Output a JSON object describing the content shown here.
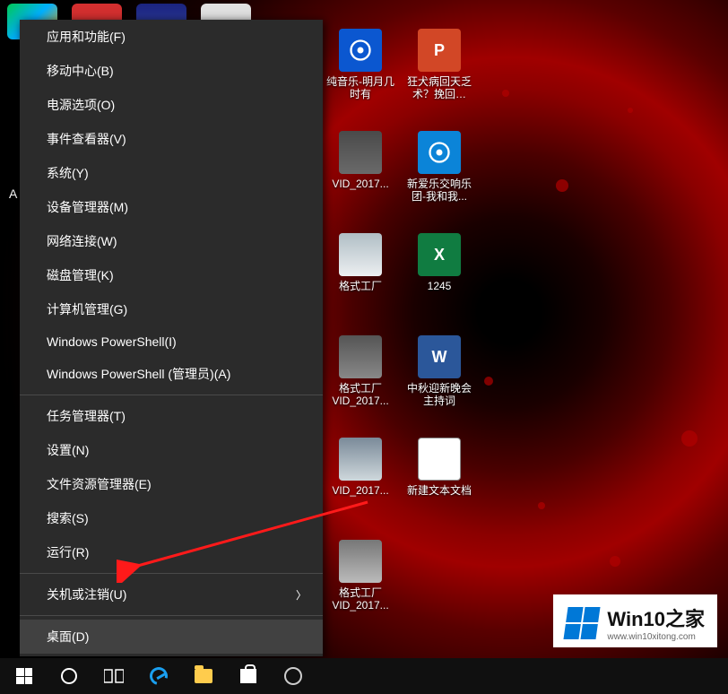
{
  "menu": {
    "section1": [
      "应用和功能(F)",
      "移动中心(B)",
      "电源选项(O)",
      "事件查看器(V)",
      "系统(Y)",
      "设备管理器(M)",
      "网络连接(W)",
      "磁盘管理(K)",
      "计算机管理(G)",
      "Windows PowerShell(I)",
      "Windows PowerShell (管理员)(A)"
    ],
    "section2": [
      "任务管理器(T)",
      "设置(N)",
      "文件资源管理器(E)",
      "搜索(S)",
      "运行(R)"
    ],
    "section3_sub": "关机或注销(U)",
    "section4": "桌面(D)"
  },
  "desktop": {
    "col1": [
      {
        "label": "纯音乐-明月几时有"
      },
      {
        "label": "VID_2017..."
      },
      {
        "label": "格式工厂"
      },
      {
        "label": "格式工厂\nVID_2017..."
      },
      {
        "label": "VID_2017..."
      },
      {
        "label": "格式工厂\nVID_2017..."
      }
    ],
    "col2": [
      {
        "label": "狂犬病回天乏术？挽回…"
      },
      {
        "label": "新爱乐交响乐团-我和我..."
      },
      {
        "label": "1245"
      },
      {
        "label": "中秋迎新晚会主持词"
      },
      {
        "label": "新建文本文档"
      }
    ]
  },
  "visible_text_fragment": "A",
  "watermark": {
    "title": "Win10之家",
    "url": "www.win10xitong.com"
  },
  "colors": {
    "menu_bg": "#2b2b2b",
    "menu_hover": "#414141",
    "accent_red": "#a00000",
    "win_blue": "#0078d7"
  }
}
